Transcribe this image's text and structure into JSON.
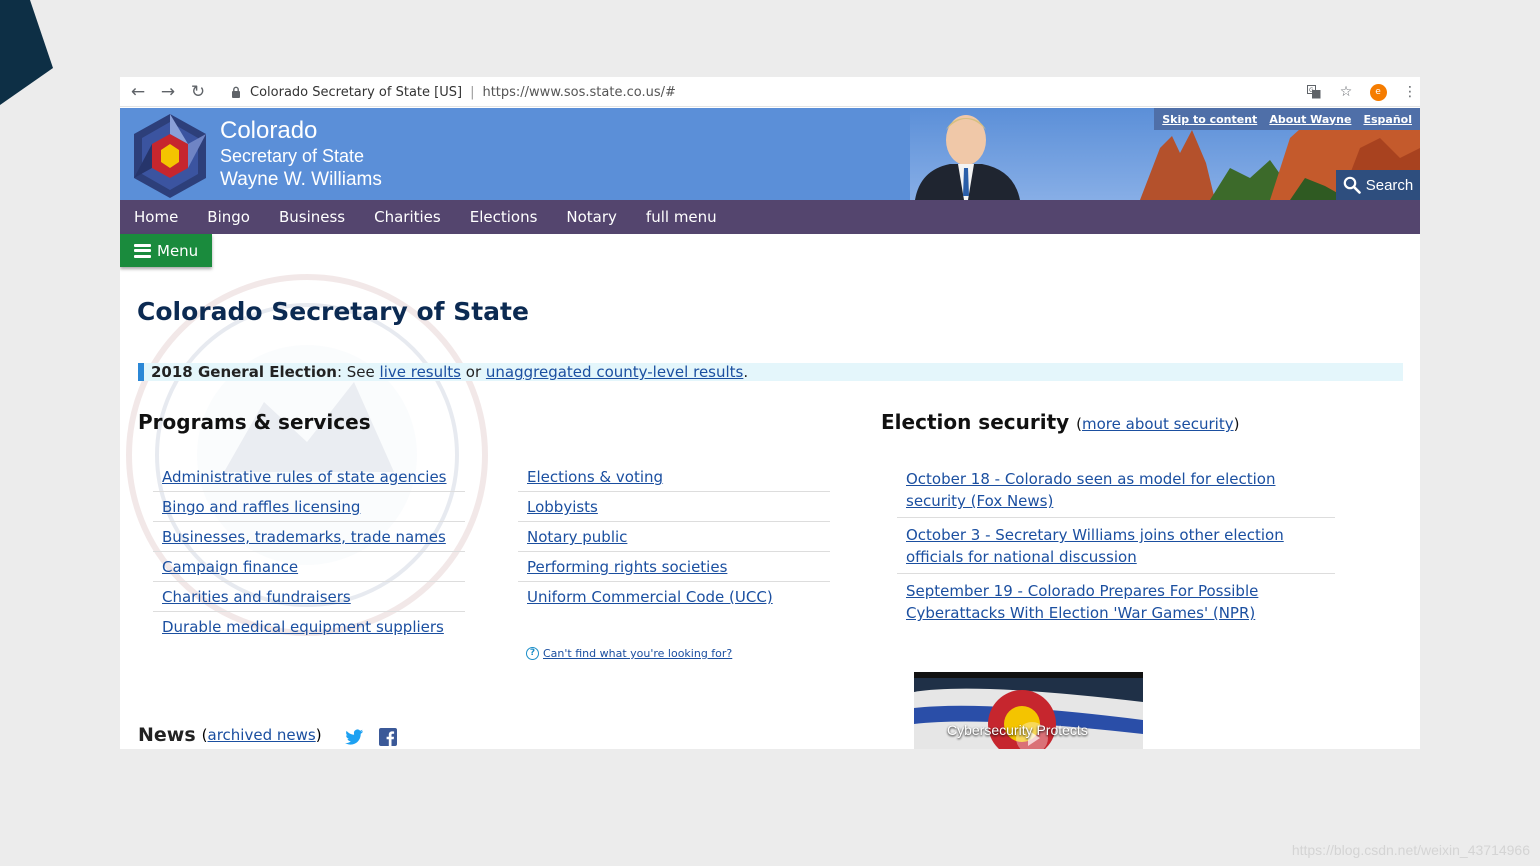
{
  "browser": {
    "site_label": "Colorado Secretary of State [US]",
    "url": "https://www.sos.state.co.us/#",
    "profile_initial": "e"
  },
  "header": {
    "line1": "Colorado",
    "line2": "Secretary of State",
    "line3": "Wayne W. Williams",
    "util_links": [
      "Skip to content",
      "About Wayne",
      "Español"
    ],
    "search_label": "Search"
  },
  "nav": [
    "Home",
    "Bingo",
    "Business",
    "Charities",
    "Elections",
    "Notary",
    "full menu"
  ],
  "menu_label": "Menu",
  "page_title": "Colorado Secretary of State",
  "alert": {
    "lead": "2018 General Election",
    "text1": ": See ",
    "link1": "live results",
    "text2": " or ",
    "link2": "unaggregated county-level results",
    "text3": "."
  },
  "programs": {
    "title": "Programs & services",
    "col1": [
      "Administrative rules of state agencies",
      "Bingo and raffles licensing",
      "Businesses, trademarks, trade names",
      "Campaign finance",
      "Charities and fundraisers",
      "Durable medical equipment suppliers"
    ],
    "col2": [
      "Elections & voting",
      "Lobbyists",
      "Notary public",
      "Performing rights societies",
      "Uniform Commercial Code (UCC)"
    ],
    "cant_find": "Can't find what you're looking for?"
  },
  "security": {
    "title": "Election security",
    "more_open": "(",
    "more_link": "more about security",
    "more_close": ")",
    "items": [
      "October 18 - Colorado seen as model for election security (Fox News)",
      "October 3 - Secretary Williams joins other election officials for national discussion",
      "September 19 - Colorado Prepares For Possible Cyberattacks With Election 'War Games' (NPR)"
    ],
    "video_caption": "Cybersecurity Protects"
  },
  "news": {
    "title": "News",
    "open": "(",
    "link": "archived news",
    "close": ")"
  },
  "watermark": "https://blog.csdn.net/weixin_43714966",
  "colors": {
    "header_blue": "#5b8fd8",
    "nav_purple": "#54456e",
    "menu_green": "#1a8b3d",
    "link_blue": "#1b4fa0",
    "title_navy": "#0b2a52"
  }
}
